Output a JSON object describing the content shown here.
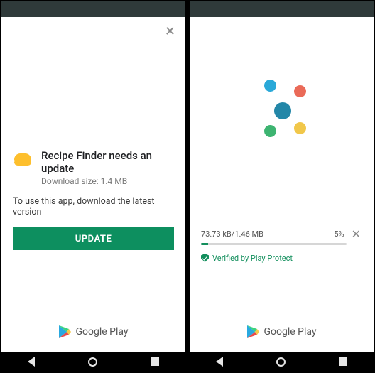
{
  "left": {
    "title": "Recipe Finder needs an update",
    "download_size_label": "Download size: 1.4 MB",
    "description": "To use this app, download the latest version",
    "update_button": "UPDATE",
    "brand": "Google Play"
  },
  "right": {
    "progress_label": "73.73 kB/1.46 MB",
    "progress_percent_label": "5%",
    "progress_percent_value": 5,
    "verified_label": "Verified by Play Protect",
    "brand": "Google Play",
    "spinner_colors": {
      "blue": "#2aa8d8",
      "red": "#ea6a58",
      "green": "#3db471",
      "yellow": "#f1c74a",
      "center": "#2387a8"
    }
  }
}
